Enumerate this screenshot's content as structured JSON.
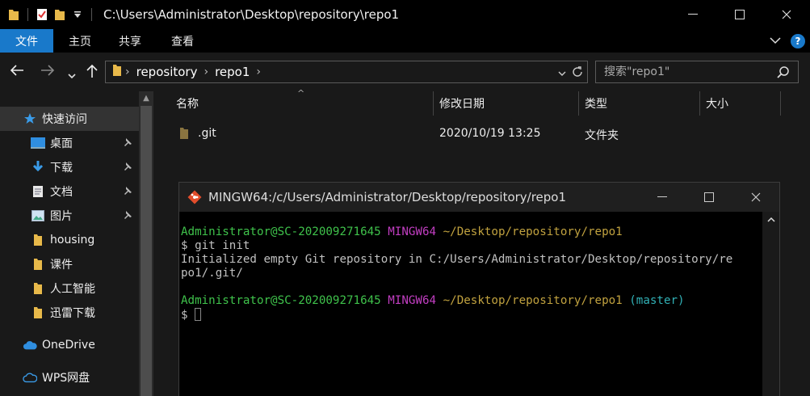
{
  "window": {
    "title": "C:\\Users\\Administrator\\Desktop\\repository\\repo1",
    "minimize": "—",
    "maximize": "☐",
    "close": "✕"
  },
  "ribbon": {
    "tabs": [
      "文件",
      "主页",
      "共享",
      "查看"
    ],
    "active_tab": "文件",
    "accent_color": "#1979ca"
  },
  "address": {
    "segments": [
      "repository",
      "repo1"
    ],
    "search_placeholder": "搜索\"repo1\""
  },
  "nav": {
    "quick_access": "快速访问",
    "items": [
      {
        "label": "桌面",
        "icon": "desktop-icon",
        "pinned": true
      },
      {
        "label": "下载",
        "icon": "download-icon",
        "pinned": true
      },
      {
        "label": "文档",
        "icon": "document-icon",
        "pinned": true
      },
      {
        "label": "图片",
        "icon": "picture-icon",
        "pinned": true
      },
      {
        "label": "housing",
        "icon": "folder-icon",
        "pinned": false
      },
      {
        "label": "课件",
        "icon": "folder-icon",
        "pinned": false
      },
      {
        "label": "人工智能",
        "icon": "folder-icon",
        "pinned": false
      },
      {
        "label": "迅雷下载",
        "icon": "folder-icon",
        "pinned": false
      }
    ],
    "onedrive": "OneDrive",
    "wps": "WPS网盘"
  },
  "columns": {
    "name": "名称",
    "modified": "修改日期",
    "type": "类型",
    "size": "大小"
  },
  "files": [
    {
      "name": ".git",
      "modified": "2020/10/19 13:25",
      "type": "文件夹",
      "size": ""
    }
  ],
  "terminal": {
    "title": "MINGW64:/c/Users/Administrator/Desktop/repository/repo1",
    "prompt1": {
      "user": "Administrator@SC-202009271645",
      "env": "MINGW64",
      "path": "~/Desktop/repository/repo1",
      "branch": ""
    },
    "cmd1": "$ git init",
    "output1": "Initialized empty Git repository in C:/Users/Administrator/Desktop/repository/re",
    "output2": "po1/.git/",
    "prompt2": {
      "user": "Administrator@SC-202009271645",
      "env": "MINGW64",
      "path": "~/Desktop/repository/repo1",
      "branch": "(master)"
    },
    "cmd2": "$"
  }
}
